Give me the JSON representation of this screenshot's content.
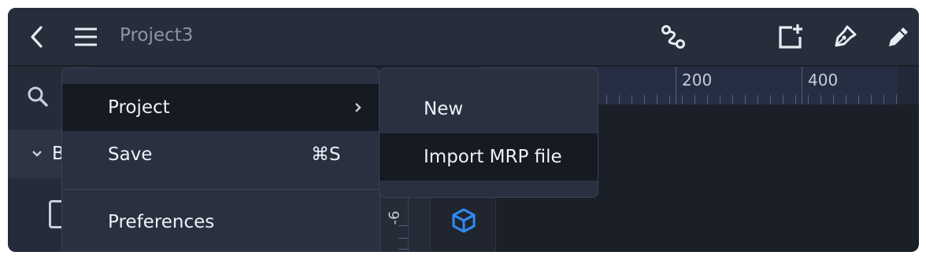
{
  "header": {
    "title": "Project3",
    "icons": [
      "back-icon",
      "hamburger-menu-icon",
      "path-node-icon",
      "add-artboard-icon",
      "pen-tool-icon",
      "pencil-icon"
    ]
  },
  "sidebar": {
    "search_icon": "search-icon",
    "group_label": "B"
  },
  "ruler": {
    "labels": [
      "200",
      "400"
    ],
    "vertical_label": "-6"
  },
  "menu": {
    "items": [
      {
        "label": "Project",
        "has_submenu": true
      },
      {
        "label": "Save",
        "shortcut": "⌘S"
      },
      {
        "label": "Preferences"
      }
    ]
  },
  "submenu": {
    "items": [
      {
        "label": "New"
      },
      {
        "label": "Import MRP file"
      }
    ]
  },
  "colors": {
    "topbar": "#272d3b",
    "menu_bg": "#2a3040",
    "menu_active": "#161a22",
    "accent_blue": "#2f8cf5"
  }
}
